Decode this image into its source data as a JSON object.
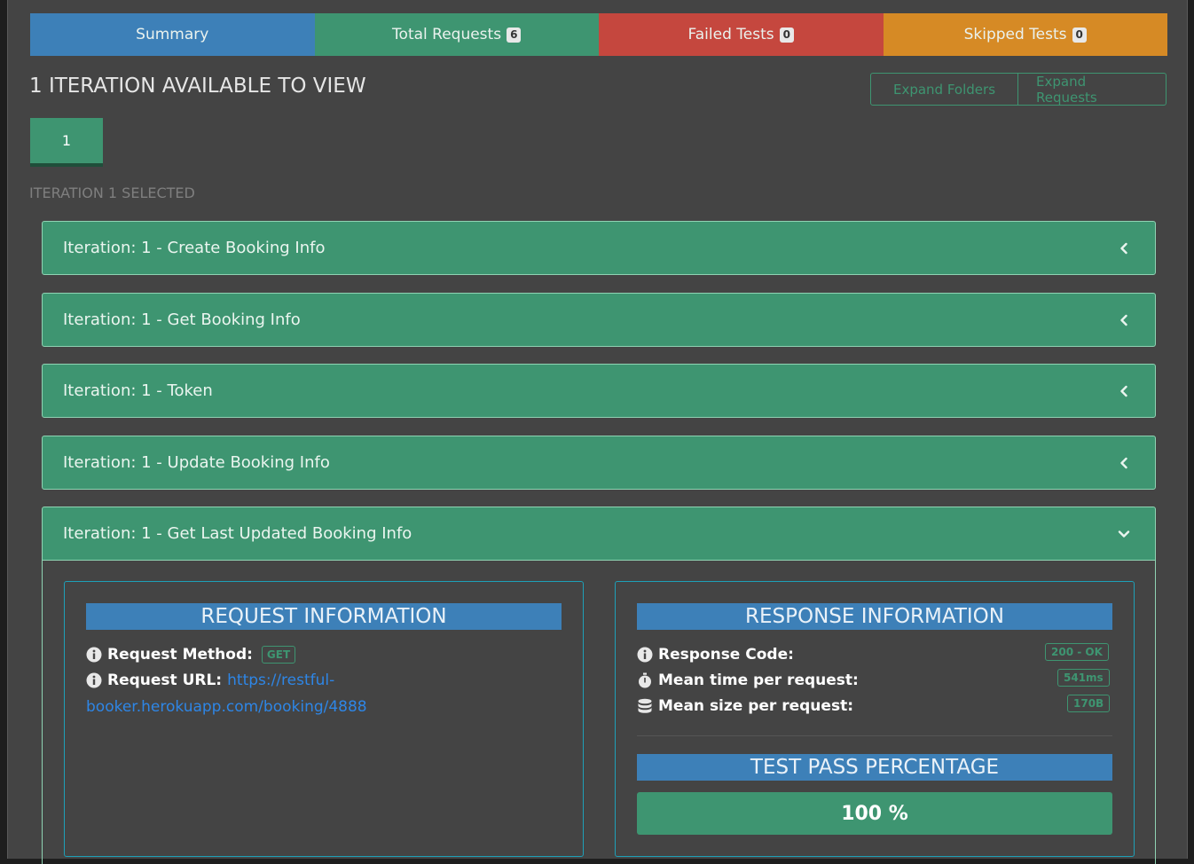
{
  "tabs": [
    {
      "label": "Summary",
      "badge": null
    },
    {
      "label": "Total Requests",
      "badge": "6"
    },
    {
      "label": "Failed Tests",
      "badge": "0"
    },
    {
      "label": "Skipped Tests",
      "badge": "0"
    }
  ],
  "heading": "1 ITERATION AVAILABLE TO VIEW",
  "expand": {
    "folders": "Expand Folders",
    "requests": "Expand Requests"
  },
  "iteration_button": "1",
  "iteration_selected": "ITERATION 1 SELECTED",
  "panels": [
    {
      "title": "Iteration: 1 - Create Booking Info",
      "open": false
    },
    {
      "title": "Iteration: 1 - Get Booking Info",
      "open": false
    },
    {
      "title": "Iteration: 1 - Token",
      "open": false
    },
    {
      "title": "Iteration: 1 - Update Booking Info",
      "open": false
    },
    {
      "title": "Iteration: 1 - Get Last Updated Booking Info",
      "open": true
    }
  ],
  "request": {
    "header": "REQUEST INFORMATION",
    "method_label": "Request Method:",
    "method": "GET",
    "url_label": "Request URL:",
    "url_part1": "https://restful-",
    "url_part2": "booker.herokuapp.com/booking/4888"
  },
  "response": {
    "header": "RESPONSE INFORMATION",
    "code_label": "Response Code:",
    "code": "200 - OK",
    "time_label": "Mean time per request:",
    "time": "541ms",
    "size_label": "Mean size per request:",
    "size": "170B",
    "test_header": "TEST PASS PERCENTAGE",
    "pass_percent_text": "100 %",
    "pass_percent": 100
  },
  "colors": {
    "summary": "#3d80b8",
    "success": "#3e9571",
    "failed": "#c5473e",
    "skipped": "#d68a25",
    "link": "#2e86e6",
    "background": "#444444"
  }
}
